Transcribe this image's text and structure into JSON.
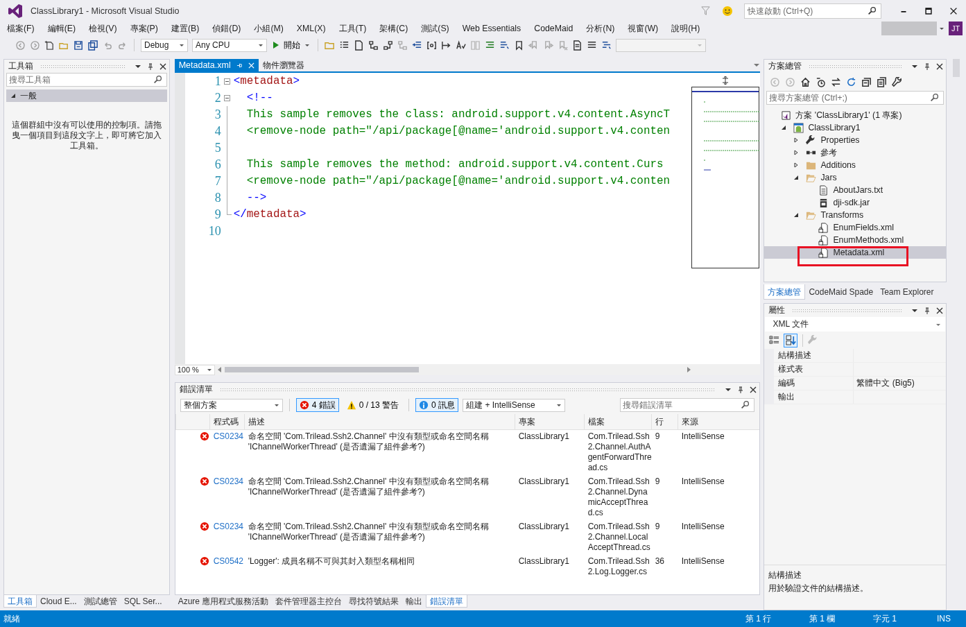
{
  "window": {
    "title": "ClassLibrary1 - Microsoft Visual Studio"
  },
  "quick_launch": {
    "placeholder": "快速啟動 (Ctrl+Q)"
  },
  "account": {
    "initials": "JT"
  },
  "menu": [
    "檔案(F)",
    "編輯(E)",
    "檢視(V)",
    "專案(P)",
    "建置(B)",
    "偵錯(D)",
    "小組(M)",
    "XML(X)",
    "工具(T)",
    "架構(C)",
    "測試(S)",
    "Web Essentials",
    "CodeMaid",
    "分析(N)",
    "視窗(W)",
    "說明(H)"
  ],
  "toolbar": {
    "configuration": "Debug",
    "platform": "Any CPU",
    "start": "開始"
  },
  "toolbox": {
    "title": "工具箱",
    "search": {
      "placeholder": "搜尋工具箱"
    },
    "group": {
      "label": "一般",
      "expanded": true
    },
    "empty_message": "這個群組中沒有可以使用的控制項。請拖曳一個項目到這段文字上，即可將它加入工具箱。"
  },
  "editor": {
    "tabs": [
      {
        "label": "Metadata.xml",
        "selected": true
      },
      {
        "label": "物件瀏覽器",
        "selected": false
      }
    ],
    "lines": [
      {
        "number": "1",
        "fold": true,
        "tokens": [
          {
            "kind": "bracket",
            "text": "<"
          },
          {
            "kind": "tag",
            "text": "metadata"
          },
          {
            "kind": "bracket",
            "text": ">"
          }
        ]
      },
      {
        "number": "2",
        "fold": true,
        "tokens": [
          {
            "kind": "bracket",
            "text": "  <!--"
          }
        ]
      },
      {
        "number": "3",
        "fold": false,
        "tokens": [
          {
            "kind": "comment",
            "text": "  This sample removes the class: android.support.v4.content.AsyncT"
          }
        ]
      },
      {
        "number": "4",
        "fold": false,
        "tokens": [
          {
            "kind": "comment",
            "text": "  <remove-node path=\"/api/package[@name='android.support.v4.conten"
          }
        ]
      },
      {
        "number": "5",
        "fold": false
      },
      {
        "number": "6",
        "fold": false,
        "tokens": [
          {
            "kind": "comment",
            "text": "  This sample removes the method: android.support.v4.content.Curs"
          }
        ]
      },
      {
        "number": "7",
        "fold": false,
        "tokens": [
          {
            "kind": "comment",
            "text": "  <remove-node path=\"/api/package[@name='android.support.v4.conten"
          }
        ]
      },
      {
        "number": "8",
        "fold": false,
        "tokens": [
          {
            "kind": "bracket",
            "text": "  -->"
          }
        ]
      },
      {
        "number": "9",
        "fold": false,
        "tokens": [
          {
            "kind": "bracket",
            "text": "</"
          },
          {
            "kind": "tag",
            "text": "metadata"
          },
          {
            "kind": "bracket",
            "text": ">"
          }
        ]
      },
      {
        "number": "10",
        "fold": false
      }
    ],
    "zoom": "100 %"
  },
  "error_list": {
    "title": "錯誤清單",
    "scope": "整個方案",
    "filters": [
      {
        "kind": "error",
        "label": "4 錯誤",
        "selected": true
      },
      {
        "kind": "warning",
        "label": "0 / 13 警告",
        "selected": false
      },
      {
        "kind": "info",
        "label": "0 訊息",
        "selected": true
      }
    ],
    "build_filter": "組建 + IntelliSense",
    "search": {
      "placeholder": "搜尋錯誤清單"
    },
    "columns": [
      "程式碼",
      "描述",
      "專案",
      "檔案",
      "行",
      "來源"
    ],
    "rows": [
      {
        "code": "CS0234",
        "description": "命名空間 'Com.Trilead.Ssh2.Channel' 中沒有類型或命名空間名稱 'IChannelWorkerThread' (是否遺漏了組件參考?)",
        "project": "ClassLibrary1",
        "file": "Com.Trilead.Ssh2.Channel.AuthAgentForwardThread.cs",
        "line": "9",
        "source": "IntelliSense"
      },
      {
        "code": "CS0234",
        "description": "命名空間 'Com.Trilead.Ssh2.Channel' 中沒有類型或命名空間名稱 'IChannelWorkerThread' (是否遺漏了組件參考?)",
        "project": "ClassLibrary1",
        "file": "Com.Trilead.Ssh2.Channel.DynamicAcceptThread.cs",
        "line": "9",
        "source": "IntelliSense"
      },
      {
        "code": "CS0234",
        "description": "命名空間 'Com.Trilead.Ssh2.Channel' 中沒有類型或命名空間名稱 'IChannelWorkerThread' (是否遺漏了組件參考?)",
        "project": "ClassLibrary1",
        "file": "Com.Trilead.Ssh2.Channel.LocalAcceptThread.cs",
        "line": "9",
        "source": "IntelliSense"
      },
      {
        "code": "CS0542",
        "description": "'Logger': 成員名稱不可與其封入類型名稱相同",
        "project": "ClassLibrary1",
        "file": "Com.Trilead.Ssh2.Log.Logger.cs",
        "line": "36",
        "source": "IntelliSense"
      }
    ]
  },
  "left_tabs": [
    {
      "label": "工具箱",
      "selected": true
    },
    {
      "label": "Cloud E...",
      "selected": false
    },
    {
      "label": "測試總管",
      "selected": false
    },
    {
      "label": "SQL Ser...",
      "selected": false
    }
  ],
  "bottom_tabs": [
    {
      "label": "Azure 應用程式服務活動",
      "selected": false
    },
    {
      "label": "套件管理器主控台",
      "selected": false
    },
    {
      "label": "尋找符號結果",
      "selected": false
    },
    {
      "label": "輸出",
      "selected": false
    },
    {
      "label": "錯誤清單",
      "selected": true
    }
  ],
  "solution_explorer": {
    "title": "方案總管",
    "search": {
      "placeholder": "搜尋方案總管 (Ctrl+;)"
    },
    "tree": [
      {
        "kind": "solution",
        "label": "方案 'ClassLibrary1' (1 專案)",
        "selected": false,
        "highlighted": false,
        "children": [
          {
            "kind": "project",
            "label": "ClassLibrary1",
            "expanded": true,
            "selected": false,
            "highlighted": false,
            "children": [
              {
                "kind": "properties",
                "label": "Properties",
                "expanded": false,
                "selected": false,
                "highlighted": false
              },
              {
                "kind": "references",
                "label": "參考",
                "expanded": false,
                "selected": false,
                "highlighted": false
              },
              {
                "kind": "folder",
                "label": "Additions",
                "expanded": false,
                "selected": false,
                "highlighted": false
              },
              {
                "kind": "folder",
                "label": "Jars",
                "expanded": true,
                "selected": false,
                "highlighted": false,
                "children": [
                  {
                    "kind": "text",
                    "label": "AboutJars.txt",
                    "selected": false,
                    "highlighted": false
                  },
                  {
                    "kind": "jar",
                    "label": "dji-sdk.jar",
                    "selected": false,
                    "highlighted": false
                  }
                ]
              },
              {
                "kind": "folder",
                "label": "Transforms",
                "expanded": true,
                "selected": false,
                "highlighted": false,
                "children": [
                  {
                    "kind": "xml",
                    "label": "EnumFields.xml",
                    "selected": false,
                    "highlighted": false
                  },
                  {
                    "kind": "xml",
                    "label": "EnumMethods.xml",
                    "selected": false,
                    "highlighted": false
                  },
                  {
                    "kind": "xml",
                    "label": "Metadata.xml",
                    "selected": true,
                    "highlighted": true
                  }
                ]
              }
            ]
          }
        ]
      }
    ]
  },
  "right_tabs": [
    {
      "label": "方案總管",
      "selected": true
    },
    {
      "label": "CodeMaid Spade",
      "selected": false
    },
    {
      "label": "Team Explorer",
      "selected": false
    }
  ],
  "properties": {
    "title": "屬性",
    "object": "XML 文件",
    "sort": [
      {
        "kind": "categorized",
        "selected": false
      },
      {
        "kind": "alphabetical",
        "selected": true
      }
    ],
    "rows": [
      {
        "name": "結構描述"
      },
      {
        "name": "樣式表"
      },
      {
        "name": "編碼",
        "value": "繁體中文 (Big5)"
      },
      {
        "name": "輸出"
      }
    ],
    "description": {
      "title": "結構描述",
      "text": "用於驗證文件的結構描述。"
    }
  },
  "status_bar": {
    "message": "就緒",
    "line": "第 1 行",
    "column": "第 1 欄",
    "char": "字元 1",
    "mode": "INS"
  }
}
